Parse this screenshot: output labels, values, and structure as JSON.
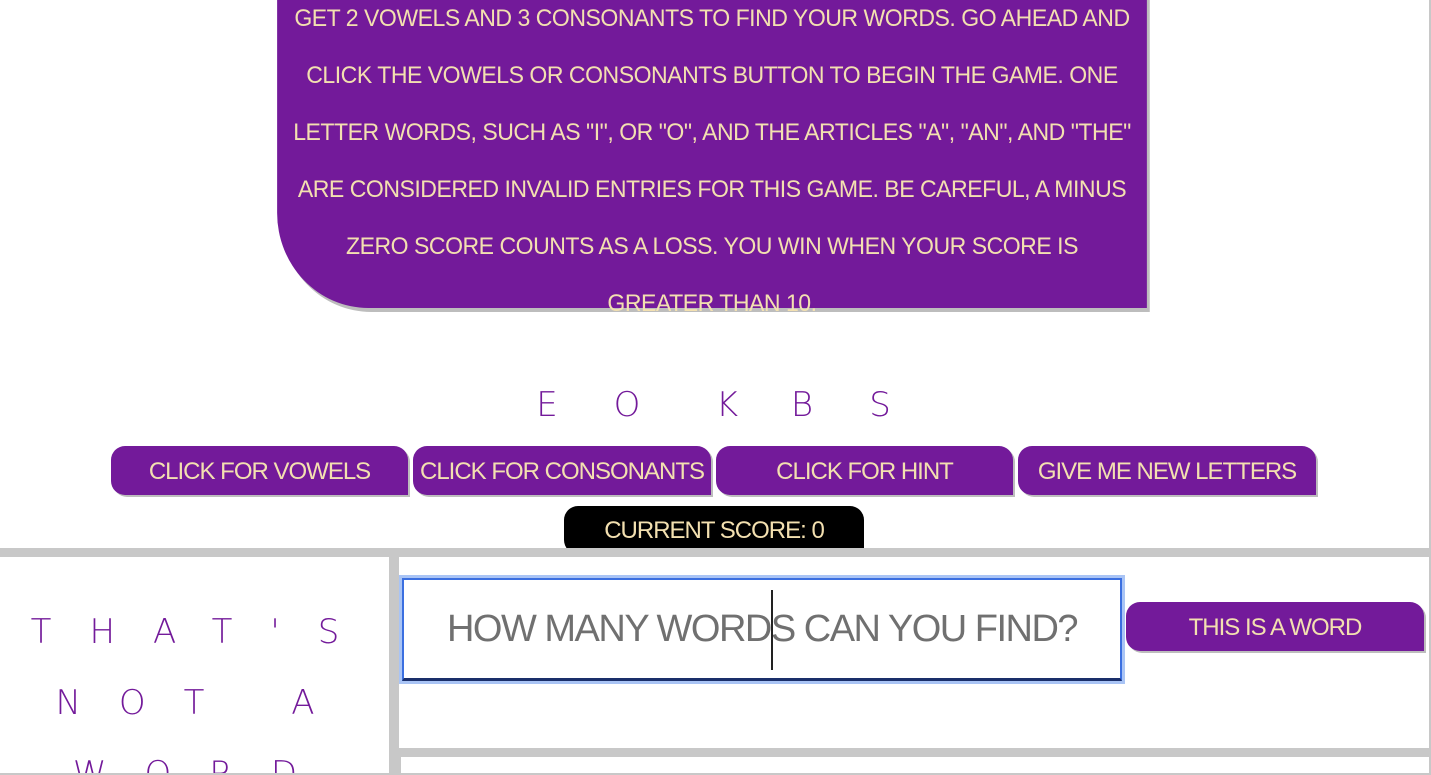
{
  "instructions": {
    "text": "Get 2 vowels and 3 consonants to find your words. Go ahead and click the vowels or consonants button to begin the game. One letter words, such as \"I\", or \"O\", and the articles \"A\", \"An\", and \"The\" are considered invalid entries for this game. Be careful, a minus zero score counts as a loss. You win when your score is greater than 10."
  },
  "letters": [
    "E",
    "O",
    "K",
    "B",
    "S"
  ],
  "buttons": {
    "vowels": "Click for vowels",
    "consonants": "Click for consonants",
    "hint": "Click for hint",
    "new_letters": "Give me new letters"
  },
  "score": {
    "label": "Current Score: 0"
  },
  "feedback": {
    "message": "That's not a word"
  },
  "word_entry": {
    "placeholder": "How many words can you find?",
    "value": ""
  },
  "submit": {
    "label": "This is a word"
  },
  "colors": {
    "primary": "#731a9a",
    "text_on_primary": "#f3e0b0",
    "score_bg": "#000000",
    "divider": "#c8c8c8"
  }
}
